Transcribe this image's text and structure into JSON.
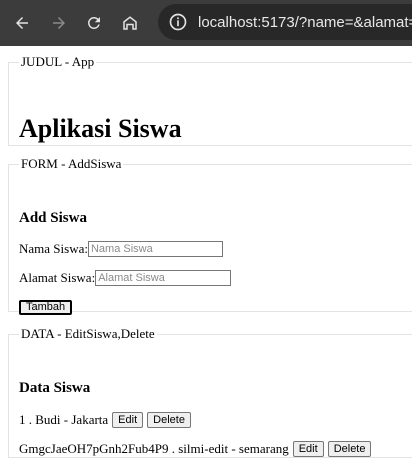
{
  "browser": {
    "url": "localhost:5173/?name=&alamat=",
    "back_icon": "arrow-left-icon",
    "forward_icon": "arrow-right-icon",
    "reload_icon": "reload-icon",
    "home_icon": "home-icon",
    "info_icon": "info-icon"
  },
  "judul": {
    "legend": "JUDUL - App",
    "title": "Aplikasi Siswa"
  },
  "form": {
    "legend": "FORM - AddSiswa",
    "heading": "Add Siswa",
    "nama_label": "Nama Siswa:",
    "nama_placeholder": "Nama Siswa",
    "nama_value": "",
    "alamat_label": "Alamat Siswa:",
    "alamat_placeholder": "Alamat Siswa",
    "alamat_value": "",
    "submit_label": "Tambah"
  },
  "data": {
    "legend": "DATA - EditSiswa,Delete",
    "heading": "Data Siswa",
    "rows": [
      {
        "text": "1 . Budi - Jakarta",
        "edit_label": "Edit",
        "delete_label": "Delete"
      },
      {
        "text": "GmgcJaeOH7pGnh2Fub4P9 . silmi-edit - semarang",
        "edit_label": "Edit",
        "delete_label": "Delete"
      }
    ]
  }
}
